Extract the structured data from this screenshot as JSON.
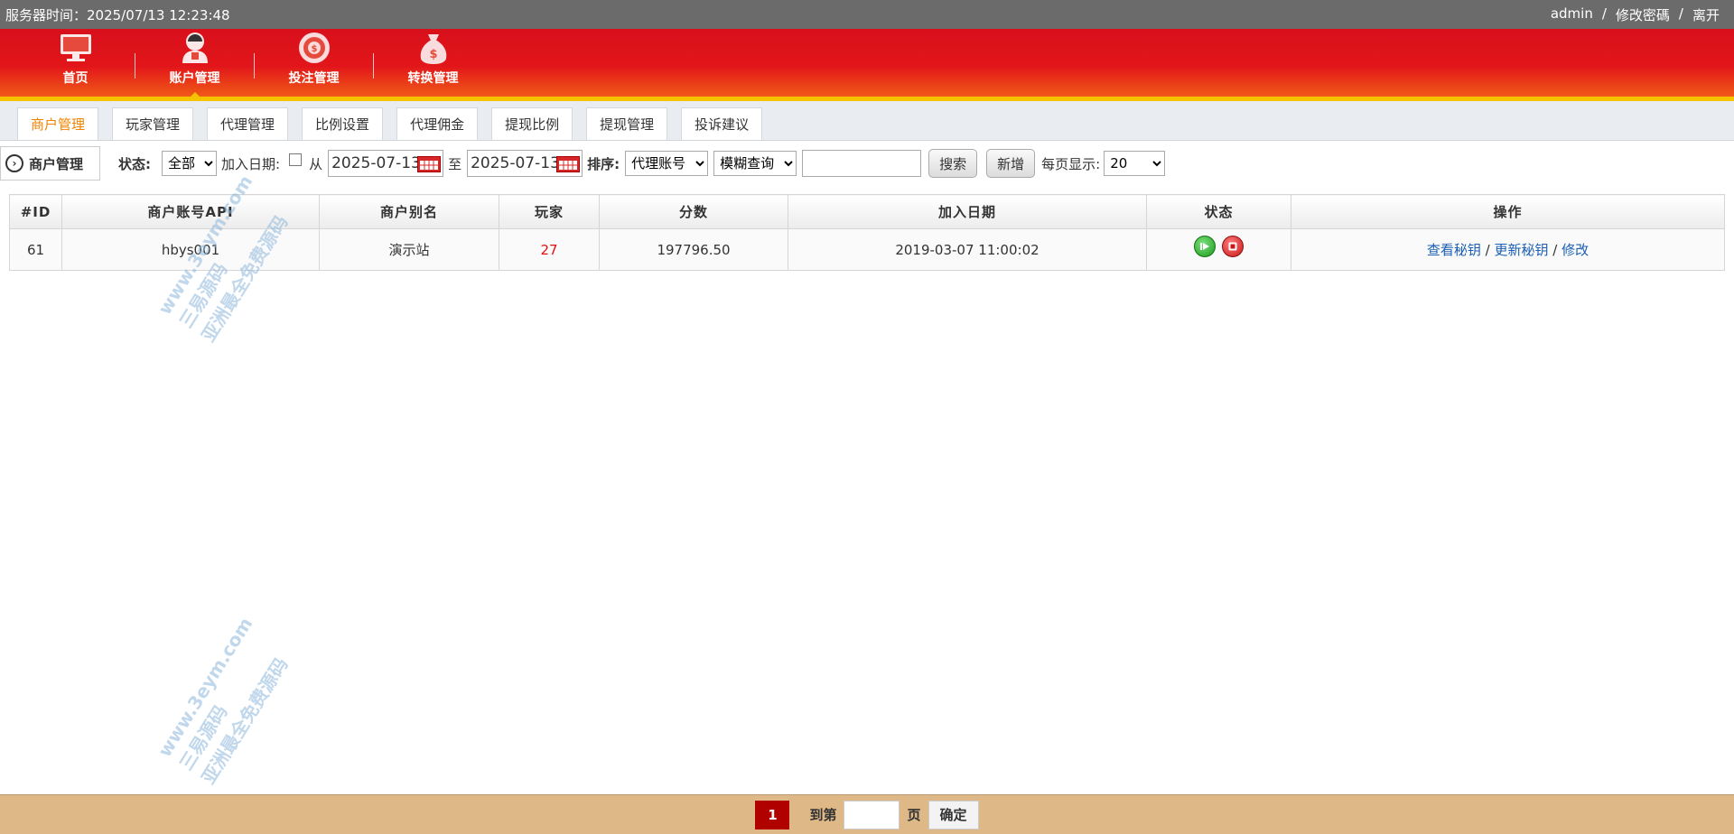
{
  "topbar": {
    "server_time": "服务器时间：2025/07/13 12:23:48",
    "user": "admin",
    "sep1": "/",
    "change_password": "修改密碼",
    "sep2": "/",
    "logout": "离开"
  },
  "nav": {
    "items": [
      {
        "label": "首页",
        "icon": "monitor-icon"
      },
      {
        "label": "账户管理",
        "icon": "user-icon"
      },
      {
        "label": "投注管理",
        "icon": "chip-icon"
      },
      {
        "label": "转换管理",
        "icon": "money-bag-icon"
      }
    ],
    "active_index": 1
  },
  "tabs": [
    {
      "label": "商户管理",
      "active": true
    },
    {
      "label": "玩家管理"
    },
    {
      "label": "代理管理"
    },
    {
      "label": "比例设置"
    },
    {
      "label": "代理佣金"
    },
    {
      "label": "提现比例"
    },
    {
      "label": "提现管理"
    },
    {
      "label": "投诉建议"
    }
  ],
  "filter": {
    "crumb": "商户管理",
    "status_label": "状态:",
    "status_value": "全部",
    "join_date_label": "加入日期:",
    "from_label": "从",
    "from_date": "2025-07-13",
    "to_label": "至",
    "to_date": "2025-07-13",
    "sort_label": "排序:",
    "sort_value": "代理账号",
    "match_value": "模糊查询",
    "search_input": "",
    "search_button": "搜索",
    "add_button": "新增",
    "per_page_label": "每页显示:",
    "per_page_value": "20"
  },
  "table": {
    "headers": [
      "#ID",
      "商户账号API",
      "商户别名",
      "玩家",
      "分数",
      "加入日期",
      "状态",
      "操作"
    ],
    "rows": [
      {
        "id": "61",
        "api": "hbys001",
        "alias": "演示站",
        "players": "27",
        "score": "197796.50",
        "date": "2019-03-07 11:00:02",
        "actions": [
          "查看秘钥",
          "更新秘钥",
          "修改"
        ],
        "sep": "/"
      }
    ]
  },
  "watermark": {
    "line1": "www.3eym.com",
    "line2": "三易源码",
    "line3": "亚洲最全免费源码"
  },
  "pager": {
    "current": "1",
    "goto_label": "到第",
    "page_label": "页",
    "confirm": "确定"
  },
  "colors": {
    "nav_red": "#d8101c",
    "nav_stripe": "#f5c400",
    "active_tab": "#f08300",
    "footer": "#deb887",
    "page_current": "#b00000",
    "link": "#1a5fb4"
  }
}
